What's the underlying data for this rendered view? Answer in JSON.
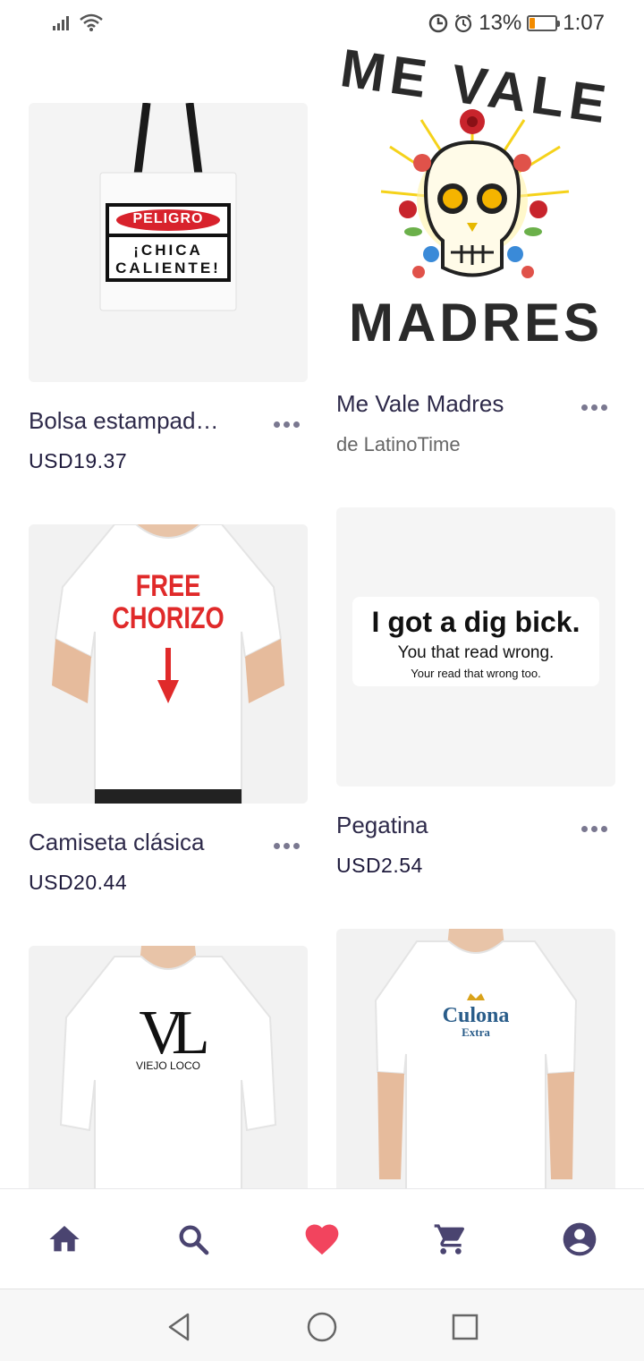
{
  "status_bar": {
    "battery": "13%",
    "time": "1:07",
    "battery_level": 0.13
  },
  "products": [
    {
      "title": "Bolsa estampad…",
      "price": "USD19.37",
      "image": {
        "sign_header": "PELIGRO",
        "sign_line1": "¡CHICA",
        "sign_line2": "CALIENTE!"
      }
    },
    {
      "title": "Me Vale Madres",
      "by": "de LatinoTime",
      "image": {
        "top_text": "ME VALE",
        "bottom_text": "MADRES"
      }
    },
    {
      "title": "Camiseta clásica",
      "price": "USD20.44",
      "image": {
        "line1": "FREE",
        "line2": "CHORIZO"
      }
    },
    {
      "title": "Pegatina",
      "price": "USD2.54",
      "image": {
        "line1": "I got a dig bick.",
        "line2": "You that read wrong.",
        "line3": "Your read that wrong too."
      }
    },
    {
      "title": "",
      "price": "",
      "image": {
        "logo": "VL",
        "caption": "VIEJO LOCO"
      }
    },
    {
      "title": "",
      "price": "",
      "image": {
        "logo": "Culona",
        "caption": "Extra"
      }
    }
  ],
  "bottom_nav": [
    {
      "name": "home",
      "icon": "home-icon"
    },
    {
      "name": "search",
      "icon": "search-icon"
    },
    {
      "name": "favorites",
      "icon": "heart-icon"
    },
    {
      "name": "cart",
      "icon": "cart-icon"
    },
    {
      "name": "account",
      "icon": "account-icon"
    }
  ],
  "colors": {
    "accent_heart": "#f2445e",
    "nav_icon": "#4a4470",
    "text_dark": "#2e2a4a"
  }
}
